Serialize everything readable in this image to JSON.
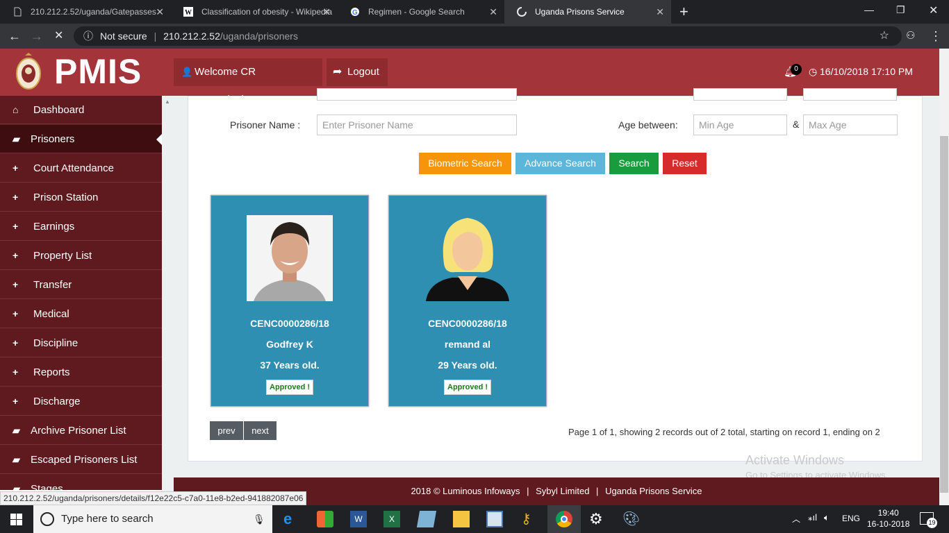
{
  "browser": {
    "tabs": [
      {
        "title": "210.212.2.52/uganda/Gatepasses",
        "icon": "page-icon"
      },
      {
        "title": "Classification of obesity - Wikipedia",
        "icon": "wikipedia-icon"
      },
      {
        "title": "Regimen - Google Search",
        "icon": "google-icon"
      },
      {
        "title": "Uganda Prisons Service",
        "icon": "loading-icon"
      }
    ],
    "security": "Not secure",
    "url_host": "210.212.2.52",
    "url_path": "/uganda/prisoners"
  },
  "header": {
    "app_name": "PMIS",
    "welcome": "Welcome CR Receptionist",
    "logout": "Logout",
    "notification_count": "0",
    "datetime": "16/10/2018 17:10 PM",
    "bg_color": "#a3343a"
  },
  "sidebar": {
    "items": [
      {
        "label": "Dashboard",
        "icon": "home-icon"
      },
      {
        "label": "Prisoners",
        "icon": "folder-icon"
      },
      {
        "label": "Court Attendance",
        "icon": "plus-icon"
      },
      {
        "label": "Prison Station",
        "icon": "plus-icon"
      },
      {
        "label": "Earnings",
        "icon": "plus-icon"
      },
      {
        "label": "Property List",
        "icon": "plus-icon"
      },
      {
        "label": "Transfer",
        "icon": "plus-icon"
      },
      {
        "label": "Medical",
        "icon": "plus-icon"
      },
      {
        "label": "Discipline",
        "icon": "plus-icon"
      },
      {
        "label": "Reports",
        "icon": "plus-icon"
      },
      {
        "label": "Discharge",
        "icon": "plus-icon"
      },
      {
        "label": "Archive Prisoner List",
        "icon": "folder-icon"
      },
      {
        "label": "Escaped Prisoners List",
        "icon": "folder-icon"
      },
      {
        "label": "Stages",
        "icon": "folder-icon"
      }
    ]
  },
  "search": {
    "name_label": "Prisoner Name :",
    "name_placeholder": "Enter Prisoner Name",
    "age_label": "Age between:",
    "amp": "&",
    "min_age_placeholder": "Min Age",
    "max_age_placeholder": "Max Age",
    "buttons": {
      "biometric": "Biometric Search",
      "advance": "Advance Search",
      "search": "Search",
      "reset": "Reset"
    }
  },
  "prisoners": [
    {
      "id": "CENC0000286/18",
      "name": "Godfrey K",
      "age": "37 Years old.",
      "status": "Approved !"
    },
    {
      "id": "CENC0000286/18",
      "name": "remand al",
      "age": "29 Years old.",
      "status": "Approved !"
    }
  ],
  "pagination": {
    "prev": "prev",
    "next": "next",
    "summary": "Page 1 of 1, showing 2 records out of 2 total, starting on record 1, ending on 2"
  },
  "footer": {
    "copyright": "2018 © Luminous Infoways",
    "sep": "|",
    "company": "Sybyl Limited",
    "org": "Uganda Prisons Service"
  },
  "status_url": "210.212.2.52/uganda/prisoners/details/f12e22c5-c7a0-11e8-b2ed-941882087e06",
  "watermark": {
    "title": "Activate Windows",
    "subtitle": "Go to Settings to activate Windows."
  },
  "taskbar": {
    "search_placeholder": "Type here to search",
    "lang": "ENG",
    "time": "19:40",
    "date": "16-10-2018",
    "notif_count": "19"
  }
}
